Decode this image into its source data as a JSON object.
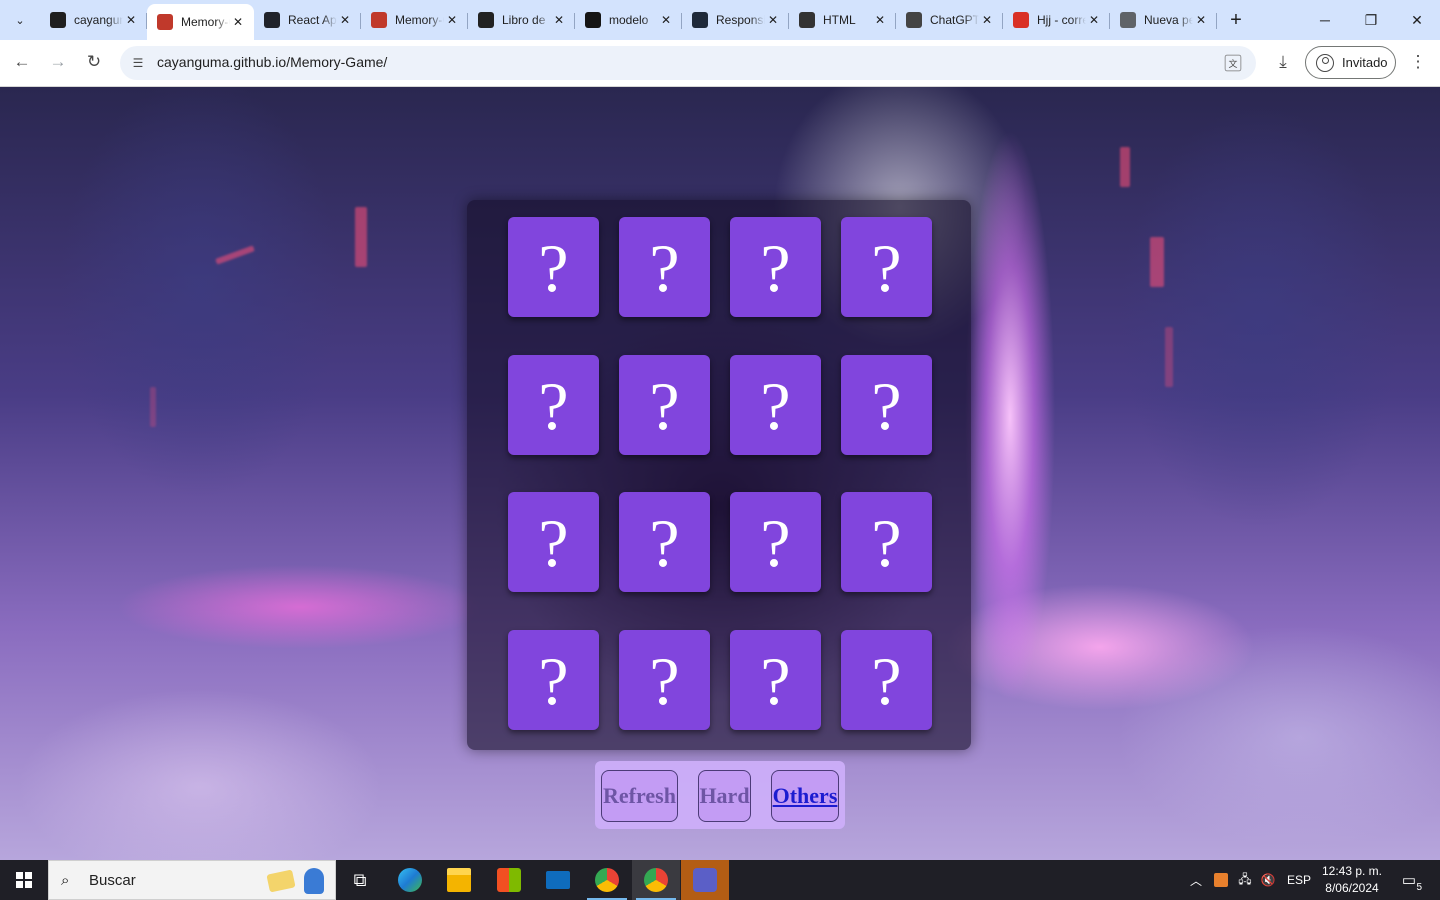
{
  "browser": {
    "tabs": [
      {
        "title": "cayanguma",
        "favicon": "github-icon",
        "color": "#1f1f1f"
      },
      {
        "title": "Memory-Game",
        "favicon": "memory-game-icon",
        "color": "#c0392b",
        "active": true
      },
      {
        "title": "React App",
        "favicon": "react-icon",
        "color": "#20232a"
      },
      {
        "title": "Memory-Game",
        "favicon": "memory-game-icon",
        "color": "#c0392b"
      },
      {
        "title": "Libro de",
        "favicon": "bar-chart-icon",
        "color": "#222222"
      },
      {
        "title": "modelo",
        "favicon": "codesandbox-icon",
        "color": "#151515"
      },
      {
        "title": "Responsive",
        "favicon": "responsive-icon",
        "color": "#1f2a3a"
      },
      {
        "title": "HTML",
        "favicon": "html-icon",
        "color": "#333333"
      },
      {
        "title": "ChatGPT",
        "favicon": "openai-icon",
        "color": "#444444"
      },
      {
        "title": "Hjj - correo",
        "favicon": "gmail-icon",
        "color": "#d93025"
      },
      {
        "title": "Nueva pestaña",
        "favicon": "globe-icon",
        "color": "#5f6368"
      }
    ],
    "new_tab_symbol": "+",
    "url": "cayanguma.github.io/Memory-Game/",
    "profile_label": "Invitado"
  },
  "game": {
    "card_symbol": "?",
    "card_color": "#8145dd",
    "cards": [
      "?",
      "?",
      "?",
      "?",
      "?",
      "?",
      "?",
      "?",
      "?",
      "?",
      "?",
      "?",
      "?",
      "?",
      "?",
      "?"
    ],
    "buttons": {
      "refresh": "Refresh",
      "hard": "Hard",
      "others": "Others"
    }
  },
  "taskbar": {
    "search_placeholder": "Buscar",
    "language": "ESP",
    "time": "12:43 p. m.",
    "date": "8/06/2024",
    "notification_count": "5"
  }
}
